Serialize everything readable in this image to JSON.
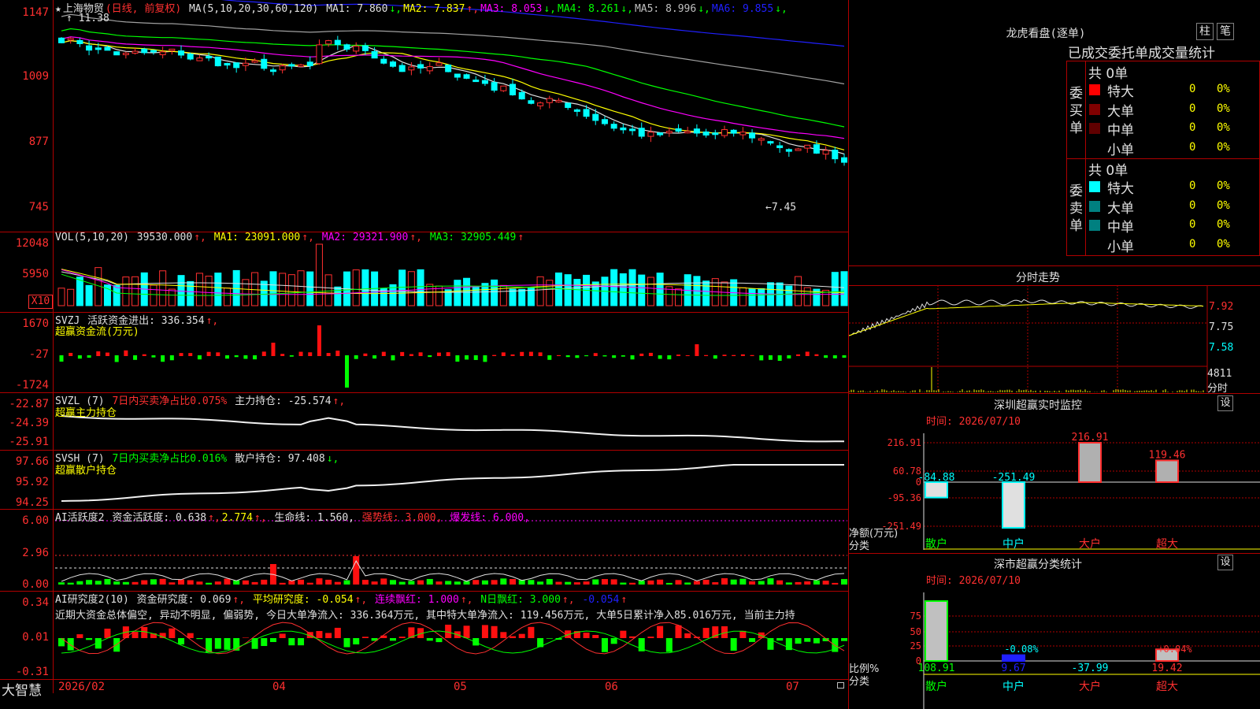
{
  "stock": {
    "name": "上海物贸",
    "mode": "(日线, 前复权)",
    "star": "★"
  },
  "main_ma": {
    "label": "MA(5,10,20,30,60,120)",
    "items": [
      {
        "name": "MA1:",
        "value": "7.860",
        "arrow": "↓",
        "color": "#e0e0e0"
      },
      {
        "name": "MA2:",
        "value": "7.837",
        "arrow": "↑",
        "color": "#ffff00"
      },
      {
        "name": "MA3:",
        "value": "8.053",
        "arrow": "↓",
        "color": "#ff00ff"
      },
      {
        "name": "MA4:",
        "value": "8.261",
        "arrow": "↓",
        "color": "#00ff00"
      },
      {
        "name": "MA5:",
        "value": "8.996",
        "arrow": "↓",
        "color": "#c0c0c0"
      },
      {
        "name": "MA6:",
        "value": "9.855",
        "arrow": "↓",
        "color": "#2020ff"
      }
    ],
    "y_labels": [
      "1147",
      "1009",
      "877",
      "745"
    ],
    "high_note": "11.38",
    "low_note": "←7.45"
  },
  "vol": {
    "label": "VOL(5,10,20)",
    "value": "39530.000",
    "ma1": "MA1: 23091.000",
    "ma2": "MA2: 29321.900",
    "ma3": "MA3: 32905.449",
    "y_labels": [
      "12048",
      "5950"
    ],
    "unit": "X10"
  },
  "svzj": {
    "label": "SVZJ",
    "title": "活跃资金进出: 336.354",
    "subtitle": "超赢资金流(万元)",
    "y_labels": [
      "1670",
      "-27",
      "-1724"
    ]
  },
  "svzl": {
    "label": "SVZL (7)",
    "ratio": "7日内买卖净占比0.075%",
    "hold": "主力持仓: -25.574",
    "subtitle": "超赢主力持仓",
    "y_labels": [
      "-22.87",
      "-24.39",
      "-25.91"
    ]
  },
  "svsh": {
    "label": "SVSH (7)",
    "ratio": "7日内买卖净占比0.016%",
    "hold": "散户持仓: 97.408",
    "subtitle": "超赢散户持仓",
    "y_labels": [
      "97.66",
      "95.92",
      "94.25"
    ]
  },
  "ai_active": {
    "label": "AI活跃度2",
    "activity": "资金活跃度: 0.638",
    "v2": "2.774",
    "life": "生命线: 1.560,",
    "strong": "强势线: 3.000,",
    "burst": "爆发线: 6.000,",
    "y_labels": [
      "6.00",
      "2.96",
      "0.00"
    ]
  },
  "ai_research": {
    "label": "AI研究度2(10)",
    "research": "资金研究度: 0.069",
    "avg": "平均研究度: -0.054",
    "cont": "连续飘红: 1.000",
    "nday": "N日飘红: 3.000",
    "last": "-0.054",
    "commentary": "近期大资金总体偏空, 异动不明显, 偏弱势, 今日大单净流入: 336.364万元, 其中特大单净流入: 119.456万元, 大单5日累计净入85.016万元, 当前主力持",
    "y_labels": [
      "0.34",
      "0.01",
      "-0.31"
    ]
  },
  "dates": [
    "2026/02",
    "04",
    "05",
    "06",
    "07"
  ],
  "brand": "大智慧",
  "lhb": {
    "title": "龙虎看盘(逐单)",
    "btn_zhu": "柱",
    "btn_bi": "笔",
    "header": "已成交委托单成交量统计",
    "buy_label": "委买单",
    "sell_label": "委卖单",
    "buy_total": "共 0单",
    "sell_total": "共 0单",
    "rows": [
      "特大",
      "大单",
      "中单",
      "小单"
    ],
    "zero": "0",
    "zero_pct": "0%",
    "buy_colors": [
      "#ff0000",
      "#800000",
      "#600000",
      "#000000"
    ],
    "sell_colors": [
      "#00ffff",
      "#008080",
      "#008080",
      "#000000"
    ]
  },
  "intraday": {
    "title": "分时走势",
    "y_labels": [
      "7.92",
      "7.75",
      "7.58"
    ],
    "vol_label": "4811",
    "vol_unit": "分时"
  },
  "sz_monitor": {
    "title": "深圳超赢实时监控",
    "btn": "设",
    "time": "时间: 2026/07/10",
    "y_labels": [
      "216.91",
      "60.78",
      "0",
      "-95.36",
      "-251.49"
    ],
    "unit_line1": "净额(万元)",
    "unit_line2": "分类",
    "categories": [
      "散户",
      "中户",
      "大户",
      "超大"
    ],
    "values": [
      -84.88,
      -251.49,
      216.91,
      119.46
    ],
    "value_labels": [
      "-84.88",
      "-251.49",
      "216.91",
      "119.46"
    ]
  },
  "sh_stats": {
    "title": "深市超赢分类统计",
    "btn": "设",
    "time": "时间: 2026/07/10",
    "y_labels": [
      "75",
      "50",
      "25",
      "0"
    ],
    "unit_line1": "比例%",
    "unit_line2": "分类",
    "categories": [
      "散户",
      "中户",
      "大户",
      "超大"
    ],
    "bar_values": [
      108.91,
      9.67,
      -37.99,
      19.42
    ],
    "bar_labels": [
      "108.91",
      "9.67",
      "-37.99",
      "19.42"
    ],
    "pct_labels": [
      "",
      "-0.08%",
      "",
      "+0.04%"
    ]
  }
}
